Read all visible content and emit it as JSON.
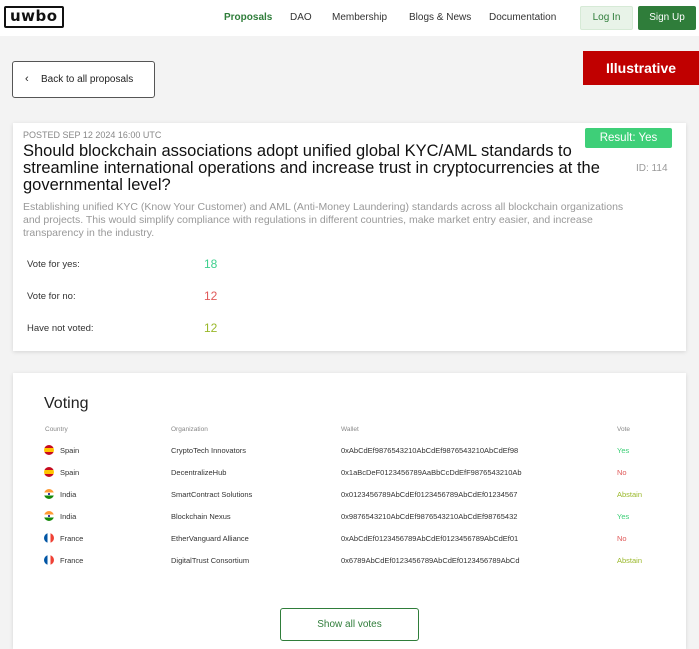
{
  "header": {
    "logo": "uwbo",
    "nav": [
      "Proposals",
      "DAO",
      "Membership",
      "Blogs & News",
      "Documentation"
    ],
    "login_label": "Log In",
    "signup_label": "Sign Up"
  },
  "back_label": "Back to all proposals",
  "overlay_label": "Illustrative",
  "proposal": {
    "posted": "POSTED SEP 12 2024 16:00 UTC",
    "result": "Result: Yes",
    "title": "Should blockchain associations adopt unified global KYC/AML standards to streamline international operations and increase trust in cryptocurrencies at the governmental level?",
    "id": "ID: 114",
    "description": "Establishing unified KYC (Know Your Customer) and AML (Anti-Money Laundering) standards across all blockchain organizations and projects. This would simplify compliance with regulations in different countries, make market entry easier, and increase transparency in the industry.",
    "stats": [
      {
        "label": "Vote for yes:",
        "value": "18",
        "color": "#3ecf8e"
      },
      {
        "label": "Vote for no:",
        "value": "12",
        "color": "#e05a5a"
      },
      {
        "label": "Have not voted:",
        "value": "12",
        "color": "#9ab82a"
      }
    ]
  },
  "voting": {
    "title": "Voting",
    "columns": [
      "Country",
      "Organization",
      "Wallet",
      "Vote"
    ],
    "rows": [
      {
        "flag": "spain",
        "country": "Spain",
        "organization": "CryptoTech Innovators",
        "wallet": "0xAbCdEf9876543210AbCdEf9876543210AbCdEf98",
        "vote": "Yes",
        "vote_color": "#3ecf78"
      },
      {
        "flag": "spain",
        "country": "Spain",
        "organization": "DecentralizeHub",
        "wallet": "0x1aBcDeF0123456789AaBbCcDdEfF9876543210Ab",
        "vote": "No",
        "vote_color": "#e05a5a"
      },
      {
        "flag": "india",
        "country": "India",
        "organization": "SmartContract Solutions",
        "wallet": "0x0123456789AbCdEf0123456789AbCdEf01234567",
        "vote": "Abstain",
        "vote_color": "#9ab82a"
      },
      {
        "flag": "india",
        "country": "India",
        "organization": "Blockchain Nexus",
        "wallet": "0x9876543210AbCdEf9876543210AbCdEf98765432",
        "vote": "Yes",
        "vote_color": "#3ecf78"
      },
      {
        "flag": "france",
        "country": "France",
        "organization": "EtherVanguard Alliance",
        "wallet": "0xAbCdEf0123456789AbCdEf0123456789AbCdEf01",
        "vote": "No",
        "vote_color": "#e05a5a"
      },
      {
        "flag": "france",
        "country": "France",
        "organization": "DigitalTrust Consortium",
        "wallet": "0x6789AbCdEf0123456789AbCdEf0123456789AbCd",
        "vote": "Abstain",
        "vote_color": "#9ab82a"
      }
    ],
    "show_all_label": "Show all votes"
  }
}
